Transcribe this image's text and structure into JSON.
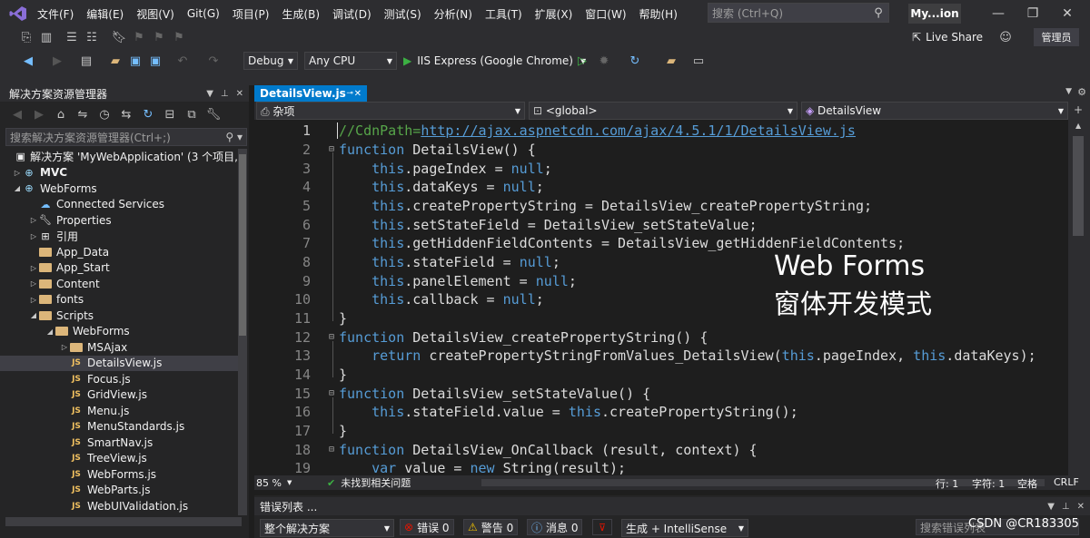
{
  "menu": [
    "文件(F)",
    "编辑(E)",
    "视图(V)",
    "Git(G)",
    "项目(P)",
    "生成(B)",
    "调试(D)",
    "测试(S)",
    "分析(N)",
    "工具(T)",
    "扩展(X)",
    "窗口(W)",
    "帮助(H)"
  ],
  "search": {
    "placeholder": "搜索 (Ctrl+Q)"
  },
  "solution_name": "My...ion",
  "live_share": "Live Share",
  "admin": "管理员",
  "toolbar": {
    "config": "Debug",
    "platform": "Any CPU",
    "run": "IIS Express (Google Chrome)"
  },
  "solution_explorer": {
    "title": "解决方案资源管理器",
    "search_placeholder": "搜索解决方案资源管理器(Ctrl+;)",
    "items": [
      {
        "label": "解决方案 'MyWebApplication' (3 个项目,"
      },
      {
        "label": "MVC"
      },
      {
        "label": "WebForms"
      },
      {
        "label": "Connected Services"
      },
      {
        "label": "Properties"
      },
      {
        "label": "引用"
      },
      {
        "label": "App_Data"
      },
      {
        "label": "App_Start"
      },
      {
        "label": "Content"
      },
      {
        "label": "fonts"
      },
      {
        "label": "Scripts"
      },
      {
        "label": "WebForms"
      },
      {
        "label": "MSAjax"
      },
      {
        "label": "DetailsView.js"
      },
      {
        "label": "Focus.js"
      },
      {
        "label": "GridView.js"
      },
      {
        "label": "Menu.js"
      },
      {
        "label": "MenuStandards.js"
      },
      {
        "label": "SmartNav.js"
      },
      {
        "label": "TreeView.js"
      },
      {
        "label": "WebForms.js"
      },
      {
        "label": "WebParts.js"
      },
      {
        "label": "WebUIValidation.js"
      }
    ]
  },
  "editor": {
    "tab": "DetailsView.js",
    "nav_project": "杂项",
    "nav_scope": "<global>",
    "nav_member": "DetailsView",
    "zoom": "85 %",
    "issues": "未找到相关问题",
    "line": "行: 1",
    "char": "字符: 1",
    "whitespace": "空格",
    "eol": "CRLF",
    "overlay_title": "Web Forms",
    "overlay_subtitle": "窗体开发模式",
    "line_numbers": [
      "1",
      "2",
      "3",
      "4",
      "5",
      "6",
      "7",
      "8",
      "9",
      "10",
      "11",
      "12",
      "13",
      "14",
      "15",
      "16",
      "17",
      "18",
      "19"
    ],
    "code": {
      "l1_prefix": "//CdnPath=",
      "l1_url": "http://ajax.aspnetcdn.com/ajax/4.5.1/1/DetailsView.js",
      "l2": "DetailsView() {",
      "l3": ".pageIndex = ",
      "l4": ".dataKeys = ",
      "l5": ".createPropertyString = DetailsView_createPropertyString;",
      "l6": ".setStateField = DetailsView_setStateValue;",
      "l7": ".getHiddenFieldContents = DetailsView_getHiddenFieldContents;",
      "l8": ".stateField = ",
      "l9": ".panelElement = ",
      "l10": ".callback = ",
      "l11": "}",
      "l12": "DetailsView_createPropertyString() {",
      "l13a": "createPropertyStringFromValues_DetailsView(",
      "l13b": ".pageIndex, ",
      "l13c": ".dataKeys);",
      "l14": "}",
      "l15": "DetailsView_setStateValue() {",
      "l16a": ".stateField.value = ",
      "l16b": ".createPropertyString();",
      "l17": "}",
      "l18": "DetailsView_OnCallback (result, context) {",
      "l19a": " value = ",
      "l19b": " String(result);",
      "kw_function": "function",
      "kw_this": "this",
      "kw_null": "null",
      "kw_return": "return",
      "kw_var": "var",
      "kw_new": "new",
      "semi": ";"
    }
  },
  "error_list": {
    "title": "错误列表 ...",
    "scope": "整个解决方案",
    "errors": "错误 0",
    "warnings": "警告 0",
    "messages": "消息 0",
    "build": "生成 + IntelliSense",
    "search": "搜索错误列表"
  },
  "watermark": "CSDN @CR183305"
}
